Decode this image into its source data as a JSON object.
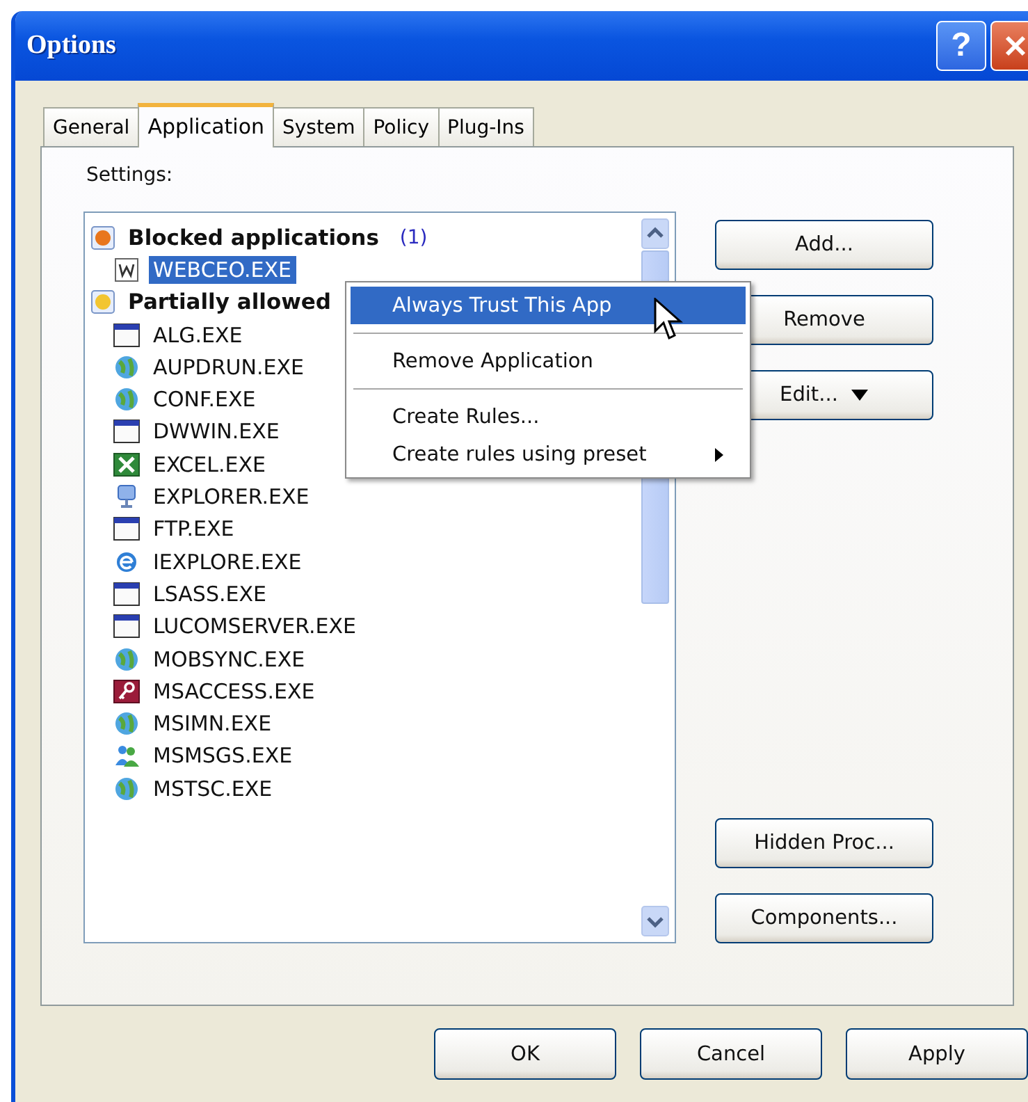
{
  "window": {
    "title": "Options",
    "help_label": "?"
  },
  "tabs": [
    {
      "label": "General",
      "selected": false
    },
    {
      "label": "Application",
      "selected": true
    },
    {
      "label": "System",
      "selected": false
    },
    {
      "label": "Policy",
      "selected": false
    },
    {
      "label": "Plug-Ins",
      "selected": false
    }
  ],
  "settings_label": "Settings:",
  "app_tree": [
    {
      "label": "Blocked applications",
      "count": "(1)",
      "kind": "blocked",
      "selected": false,
      "children": [
        {
          "label": "WEBCEO.EXE",
          "kind": "w-doc",
          "selected": true
        }
      ]
    },
    {
      "label": "Partially allowed",
      "kind": "partial",
      "selected": false,
      "children": [
        {
          "label": "ALG.EXE",
          "kind": "window",
          "selected": false
        },
        {
          "label": "AUPDRUN.EXE",
          "kind": "globe",
          "selected": false
        },
        {
          "label": "CONF.EXE",
          "kind": "globe",
          "selected": false
        },
        {
          "label": "DWWIN.EXE",
          "kind": "window",
          "selected": false
        },
        {
          "label": "EXCEL.EXE",
          "kind": "sheet",
          "selected": false
        },
        {
          "label": "EXPLORER.EXE",
          "kind": "figure",
          "selected": false
        },
        {
          "label": "FTP.EXE",
          "kind": "window",
          "selected": false
        },
        {
          "label": "IEXPLORE.EXE",
          "kind": "browser",
          "selected": false
        },
        {
          "label": "LSASS.EXE",
          "kind": "window",
          "selected": false
        },
        {
          "label": "LUCOMSERVER.EXE",
          "kind": "window",
          "selected": false
        },
        {
          "label": "MOBSYNC.EXE",
          "kind": "globe",
          "selected": false
        },
        {
          "label": "MSACCESS.EXE",
          "kind": "key",
          "selected": false
        },
        {
          "label": "MSIMN.EXE",
          "kind": "globe",
          "selected": false
        },
        {
          "label": "MSMSGS.EXE",
          "kind": "people",
          "selected": false
        },
        {
          "label": "MSTSC.EXE",
          "kind": "globe",
          "selected": false
        }
      ]
    }
  ],
  "side_buttons": [
    {
      "label": "Add...",
      "dropdown": false
    },
    {
      "label": "Remove",
      "dropdown": false
    },
    {
      "label": "Edit...",
      "dropdown": true
    }
  ],
  "lower_buttons": [
    {
      "label": "Hidden Proc..."
    },
    {
      "label": "Components..."
    }
  ],
  "context_menu": [
    {
      "kind": "item",
      "label": "Always Trust This App",
      "selected": true,
      "submenu": false
    },
    {
      "kind": "separator"
    },
    {
      "kind": "item",
      "label": "Remove Application",
      "selected": false,
      "submenu": false
    },
    {
      "kind": "separator"
    },
    {
      "kind": "item",
      "label": "Create Rules...",
      "selected": false,
      "submenu": false
    },
    {
      "kind": "item",
      "label": "Create rules using preset",
      "selected": false,
      "submenu": true
    }
  ],
  "dialog_buttons": [
    {
      "label": "OK"
    },
    {
      "label": "Cancel"
    },
    {
      "label": "Apply"
    }
  ]
}
